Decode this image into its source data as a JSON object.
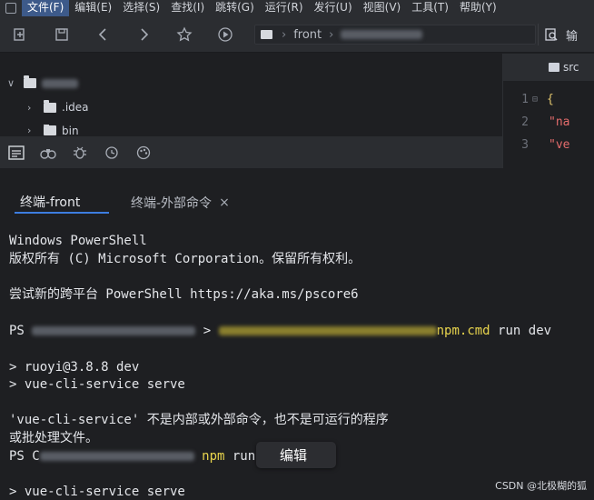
{
  "menubar": {
    "items": [
      "文件(F)",
      "编辑(E)",
      "选择(S)",
      "查找(I)",
      "跳转(G)",
      "运行(R)",
      "发行(U)",
      "视图(V)",
      "工具(T)",
      "帮助(Y)"
    ]
  },
  "toolbar": {
    "breadcrumb_segment": "front",
    "search_label": "输"
  },
  "tree": {
    "items": [
      ".idea",
      "bin"
    ]
  },
  "editor": {
    "tab_label": "src",
    "line_numbers": [
      "1",
      "2",
      "3"
    ],
    "lines": [
      "{",
      "\"na",
      "\"ve"
    ]
  },
  "terminal_tabs": {
    "active": "终端-front",
    "inactive": "终端-外部命令",
    "close": "×"
  },
  "terminal": {
    "l1": "Windows PowerShell",
    "l2": "版权所有 (C) Microsoft Corporation。保留所有权利。",
    "l3": "尝试新的跨平台 PowerShell https://aka.ms/pscore6",
    "l4_prefix": "PS",
    "l4_arrow": ">",
    "l4_cmd_tail": "npm.cmd",
    "l4_args": " run dev",
    "l5": "> ruoyi@3.8.8 dev",
    "l6": "> vue-cli-service serve",
    "l7": "'vue-cli-service' 不是内部或外部命令，也不是可运行的程序",
    "l8": "或批处理文件。",
    "l9_prefix": "PS C",
    "l9_cmd": "npm",
    "l9_args": " run",
    "l10": "> vue-cli-service serve"
  },
  "tooltip": {
    "label": "编辑"
  },
  "watermark": "CSDN @北极糊的狐"
}
